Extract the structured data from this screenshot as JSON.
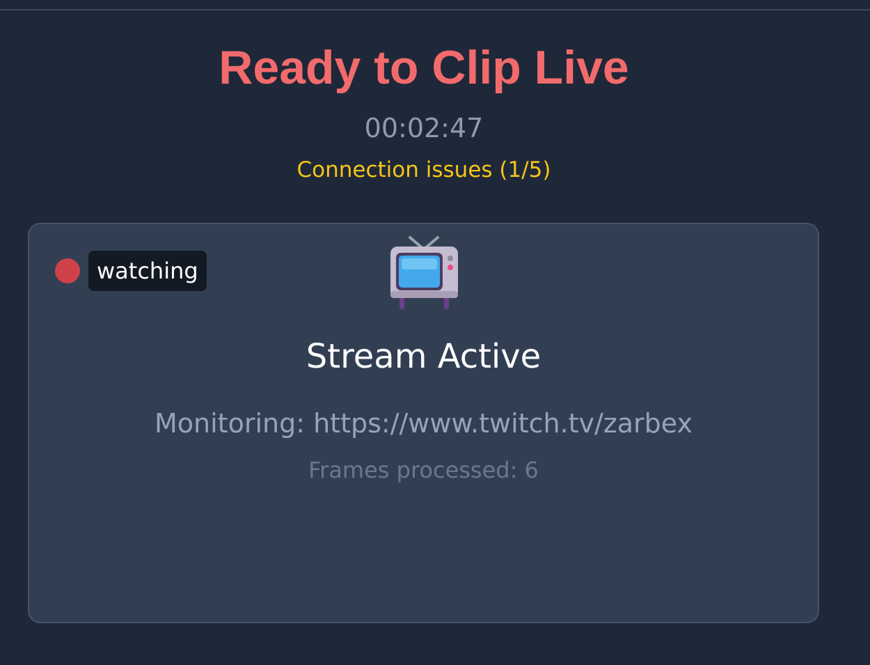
{
  "header": {
    "title": "Ready to Clip Live",
    "timer": "00:02:47",
    "connection_status": "Connection issues (1/5)"
  },
  "panel": {
    "status_label": "watching",
    "status_icon": "red-dot-icon",
    "stream_icon": "television-icon",
    "stream_title": "Stream Active",
    "monitoring_text": "Monitoring: https://www.twitch.tv/zarbex",
    "frames_text": "Frames processed: 6"
  },
  "colors": {
    "background": "#1f2839",
    "title": "#f26b6c",
    "warning": "#f5c518",
    "panel": "#323f53",
    "status_dot": "#cf4249"
  }
}
